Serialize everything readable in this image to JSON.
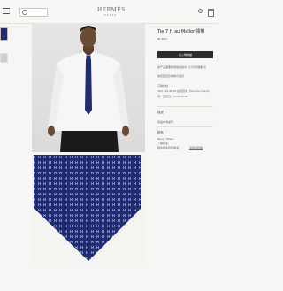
{
  "header": {
    "search_placeholder": "",
    "logo": "HERMÈS",
    "logo_sub": "PARIS"
  },
  "product": {
    "title": "Tie 7 H au Mallon领带",
    "price": "¥1,850",
    "add_button": "加入购物袋",
    "note_1": "本产品需要使用缝纫技术（只可清理面料）",
    "note_2": "免费配送及购物可退货",
    "order_label": "订购热线",
    "order_phone": "400 120 8839 在线咨询（Service Client)",
    "order_hours": "周一至周日，9:00-20:00",
    "section_1": "描述",
    "section_1_text": "商品参考编号",
    "section_2": "颜色",
    "section_2_text": "Navy / Blanc",
    "section_3_line1": "了解更多：",
    "section_3_line2": "寄件服务运费参考",
    "section_3_link": "退换货政策"
  },
  "colors": {
    "tie_navy": "#1f2c6d",
    "button_dark": "#2b2b2b",
    "background": "#f7f6f4"
  }
}
